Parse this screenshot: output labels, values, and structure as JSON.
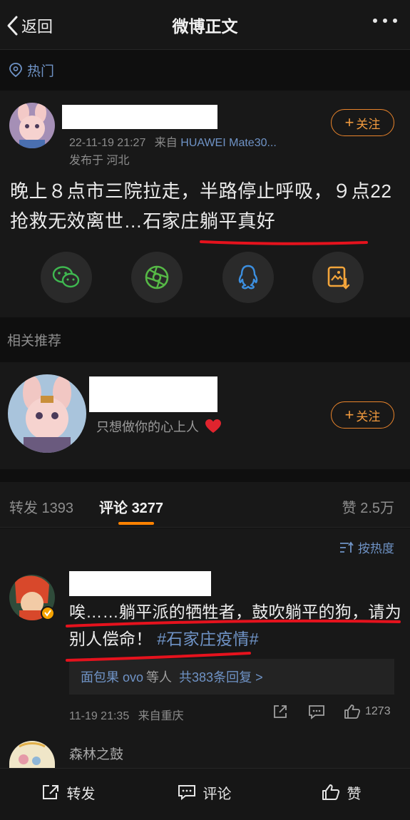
{
  "nav": {
    "back_label": "返回",
    "title": "微博正文"
  },
  "hot": {
    "label": "热门"
  },
  "post": {
    "time": "22-11-19 21:27",
    "source_prefix": "来自",
    "device": "HUAWEI Mate30...",
    "location": "发布于 河北",
    "follow_label": "关注",
    "text": "晚上８点市三院拉走，半路停止呼吸，９点22抢救无效离世…石家庄躺平真好"
  },
  "related": {
    "label": "相关推荐",
    "signature": "只想做你的心上人",
    "follow_label": "关注"
  },
  "tabs": {
    "repost": "转发 1393",
    "comment_label": "评论",
    "comment_count": "3277",
    "likes": "赞 2.5万"
  },
  "sort": {
    "label": "按热度"
  },
  "comment": {
    "text_main": "唉……躺平派的牺牲者，鼓吹躺平的狗，请为别人偿命！",
    "topic": "#石家庄疫情#",
    "reply_user": "面包果 ovo",
    "reply_text": "等人",
    "reply_count": "共383条回复 >",
    "time": "11-19 21:35",
    "source": "来自重庆",
    "like_count": "1273"
  },
  "next_comment": {
    "name": "森林之鼓"
  },
  "bottom": {
    "repost": "转发",
    "comment": "评论",
    "like": "赞"
  },
  "colors": {
    "accent": "#ff8200",
    "link": "#6f93c6",
    "annotation": "#e5121d"
  }
}
